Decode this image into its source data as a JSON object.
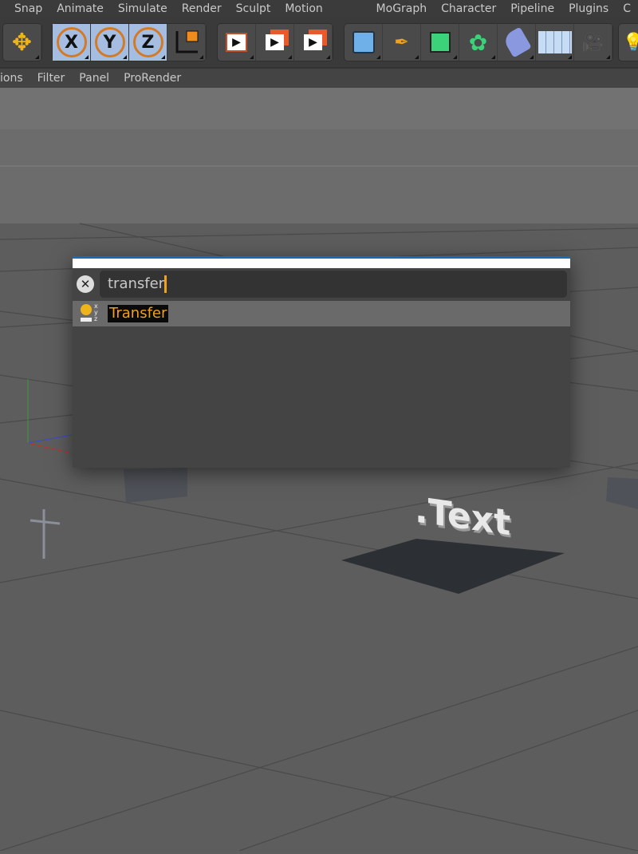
{
  "menubar": {
    "items": [
      "Snap",
      "Animate",
      "Simulate",
      "Render",
      "Sculpt",
      "Motion Tracker",
      "MoGraph",
      "Character",
      "Pipeline",
      "Plugins",
      "C"
    ]
  },
  "submenu": {
    "items": [
      "ions",
      "Filter",
      "Panel",
      "ProRender"
    ]
  },
  "toolbar": {
    "axes": [
      "X",
      "Y",
      "Z"
    ]
  },
  "viewport": {
    "text_object": ".Text"
  },
  "search_popup": {
    "query": "transfer",
    "results": [
      {
        "label": "Transfer",
        "icon": "transfer-tag-icon"
      }
    ]
  },
  "colors": {
    "accent": "#f0a21b",
    "axis_active": "#a6bde2",
    "title_border": "#1b6ab5"
  }
}
